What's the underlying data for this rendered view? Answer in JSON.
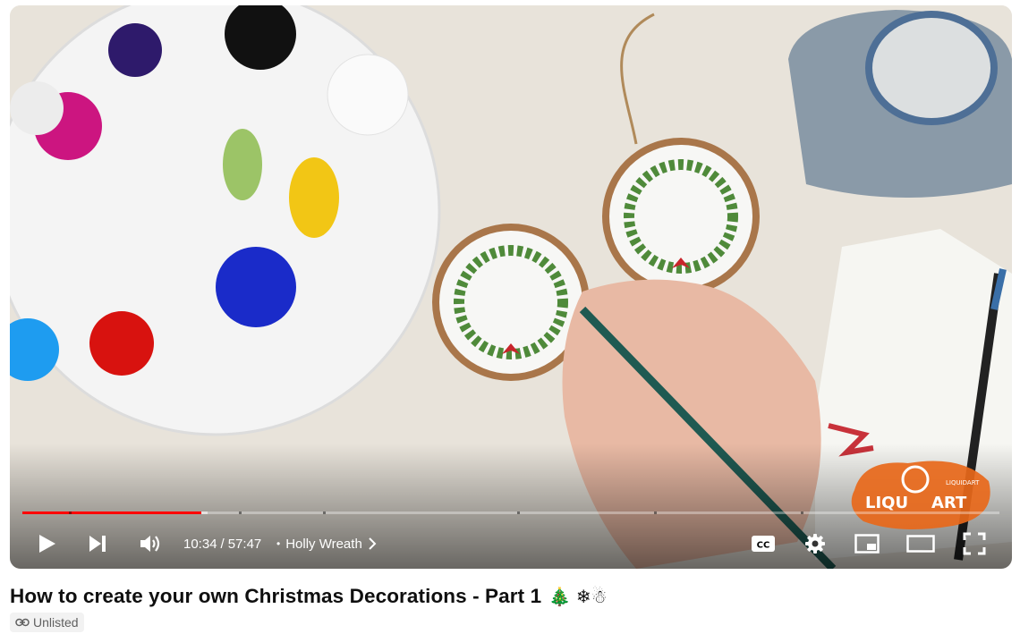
{
  "video": {
    "current_time": "10:34",
    "time_separator": "/",
    "duration": "57:47",
    "chapter_bullet": "•",
    "chapter_title": "Holly Wreath",
    "progress_played_fraction": 0.183,
    "progress_buffered_fraction": 0.19,
    "colors": {
      "played": "#ff0000",
      "controls": "#ffffff"
    }
  },
  "watermark": {
    "brand": "LIQU",
    "brand_end": "ART",
    "small": "LIQUIDART"
  },
  "controls": {
    "icons": [
      "play-icon",
      "next-icon",
      "volume-icon",
      "subtitles-icon",
      "settings-icon",
      "miniplayer-icon",
      "theater-mode-icon",
      "fullscreen-icon"
    ]
  },
  "page": {
    "title": "How to create your own Christmas Decorations - Part 1",
    "title_emoji": "🎄 ❄☃",
    "visibility_label": "Unlisted"
  }
}
